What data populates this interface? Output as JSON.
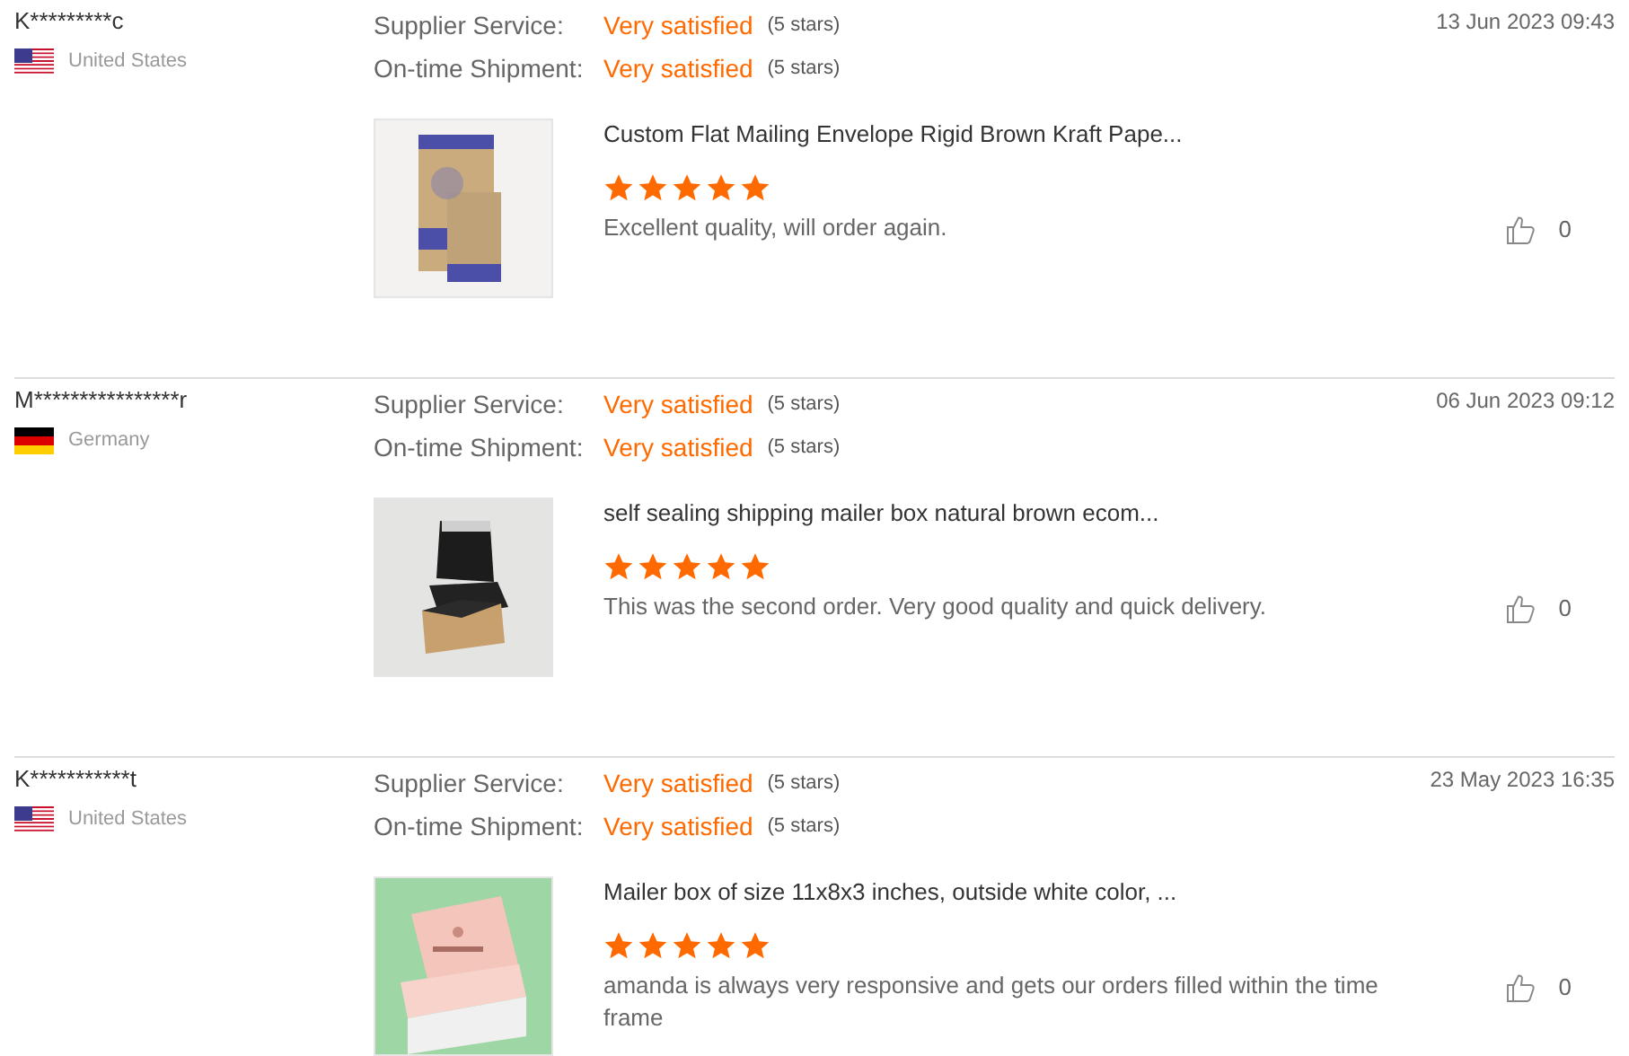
{
  "reviews": [
    {
      "reviewer": "K*********c",
      "country": "United States",
      "flag": {
        "kind": "us"
      },
      "date": "13 Jun 2023 09:43",
      "ratings": [
        {
          "label": "Supplier Service:",
          "value": "Very satisfied",
          "note": "(5 stars)"
        },
        {
          "label": "On-time Shipment:",
          "value": "Very satisfied",
          "note": "(5 stars)"
        }
      ],
      "product": {
        "kind": "picture",
        "title": "Custom Flat Mailing Envelope Rigid Brown Kraft Pape..."
      },
      "stars": 5,
      "comment": "Excellent quality, will order again.",
      "likes": "0"
    },
    {
      "reviewer": "M****************r",
      "country": "Germany",
      "flag": {
        "kind": "de"
      },
      "date": "06 Jun 2023 09:12",
      "ratings": [
        {
          "label": "Supplier Service:",
          "value": "Very satisfied",
          "note": "(5 stars)"
        },
        {
          "label": "On-time Shipment:",
          "value": "Very satisfied",
          "note": "(5 stars)"
        }
      ],
      "product": {
        "kind": "picture",
        "title": "self sealing shipping mailer box natural brown ecom..."
      },
      "stars": 5,
      "comment": "This was the second order. Very good quality and quick delivery.",
      "likes": "0"
    },
    {
      "reviewer": "K***********t",
      "country": "United States",
      "flag": {
        "kind": "us"
      },
      "date": "23 May 2023 16:35",
      "ratings": [
        {
          "label": "Supplier Service:",
          "value": "Very satisfied",
          "note": "(5 stars)"
        },
        {
          "label": "On-time Shipment:",
          "value": "Very satisfied",
          "note": "(5 stars)"
        }
      ],
      "product": {
        "kind": "picture",
        "title": "Mailer box of size 11x8x3 inches, outside white color, ..."
      },
      "stars": 5,
      "comment": "amanda is always very responsive and gets our orders filled within the time frame",
      "likes": "0"
    }
  ]
}
